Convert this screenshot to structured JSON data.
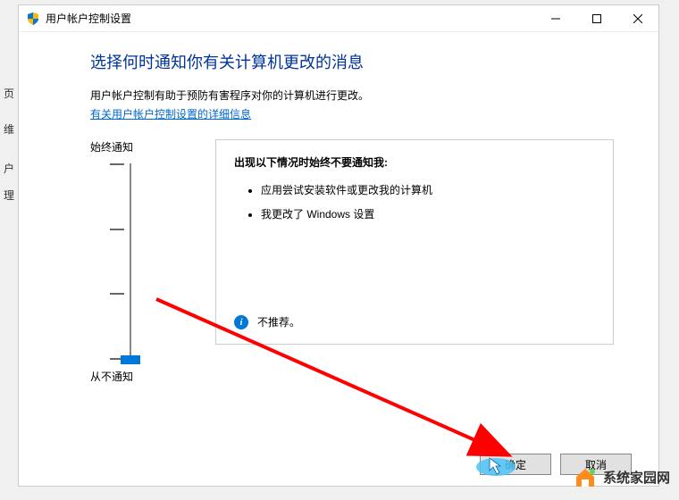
{
  "titlebar": {
    "title": "用户帐户控制设置"
  },
  "page": {
    "heading": "选择何时通知你有关计算机更改的消息",
    "description": "用户帐户控制有助于预防有害程序对你的计算机进行更改。",
    "link": "有关用户帐户控制设置的详细信息"
  },
  "slider": {
    "topLabel": "始终通知",
    "bottomLabel": "从不通知"
  },
  "infoBox": {
    "title": "出现以下情况时始终不要通知我:",
    "items": [
      "应用尝试安装软件或更改我的计算机",
      "我更改了 Windows 设置"
    ],
    "footer": "不推荐。"
  },
  "buttons": {
    "ok": "确定",
    "cancel": "取消"
  },
  "watermark": "系统家园网",
  "leftFragments": [
    "页",
    "维",
    "户",
    "理"
  ]
}
